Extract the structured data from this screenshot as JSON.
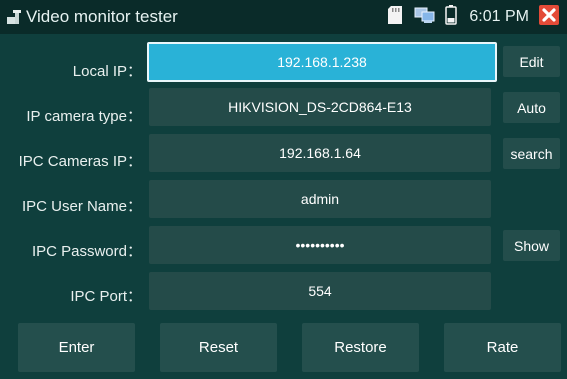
{
  "app": {
    "title": "Video monitor tester",
    "time": "6:01 PM",
    "icons": [
      "app-icon",
      "sd-card-icon",
      "network-icon",
      "battery-icon",
      "close-icon"
    ],
    "colors": {
      "background": "#0f3f3d",
      "topbar": "#0a2b29",
      "active_field": "#29b2d7",
      "close": "#e34b38"
    }
  },
  "form": {
    "local_ip": {
      "label": "Local IP：",
      "value": "192.168.1.238",
      "button": "Edit"
    },
    "camera_type": {
      "label": "IP camera type：",
      "value": "HIKVISION_DS-2CD864-E13",
      "button": "Auto"
    },
    "cameras_ip": {
      "label": "IPC Cameras IP：",
      "value": "192.168.1.64",
      "button": "search"
    },
    "user_name": {
      "label": "IPC User Name：",
      "value": "admin"
    },
    "password": {
      "label": "IPC Password：",
      "value": "••••••••••",
      "button": "Show"
    },
    "port": {
      "label": "IPC Port：",
      "value": "554"
    }
  },
  "actions": {
    "enter": "Enter",
    "reset": "Reset",
    "restore": "Restore",
    "rate": "Rate"
  }
}
